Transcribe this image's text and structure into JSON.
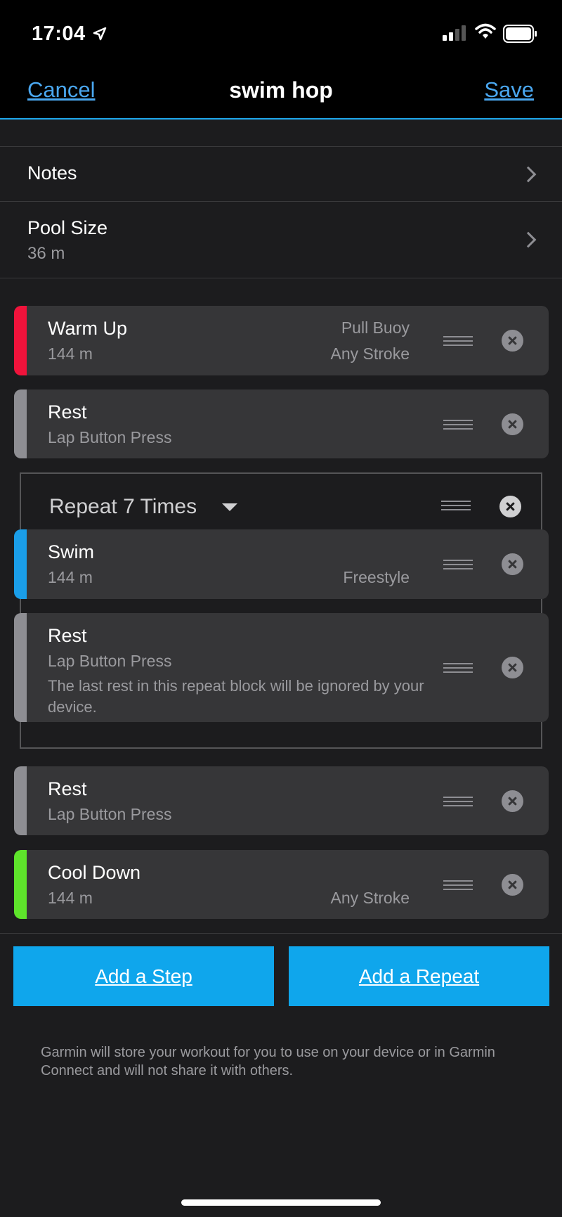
{
  "status_bar": {
    "time": "17:04",
    "icons": [
      "location-arrow-icon",
      "signal-icon",
      "wifi-icon",
      "battery-icon"
    ]
  },
  "navbar": {
    "cancel_label": "Cancel",
    "title": "swim hop",
    "save_label": "Save"
  },
  "settings": {
    "notes_label": "Notes",
    "pool_size_label": "Pool Size",
    "pool_size_value": "36 m"
  },
  "steps": [
    {
      "title": "Warm Up",
      "distance": "144 m",
      "equipment": "Pull Buoy",
      "stroke": "Any Stroke",
      "color": "#f0133b"
    },
    {
      "title": "Rest",
      "detail": "Lap Button Press",
      "color": "#8e8e93"
    }
  ],
  "repeat": {
    "label": "Repeat 7 Times",
    "steps": [
      {
        "title": "Swim",
        "distance": "144 m",
        "stroke": "Freestyle",
        "color": "#1a9ee9"
      },
      {
        "title": "Rest",
        "detail": "Lap Button Press",
        "note": "The last rest in this repeat block will be ignored by your device.",
        "color": "#8e8e93"
      }
    ]
  },
  "steps_after": [
    {
      "title": "Rest",
      "detail": "Lap Button Press",
      "color": "#8e8e93"
    },
    {
      "title": "Cool Down",
      "distance": "144 m",
      "stroke": "Any Stroke",
      "color": "#5ee42b"
    }
  ],
  "actions": {
    "add_step": "Add a Step",
    "add_repeat": "Add a Repeat"
  },
  "disclaimer": "Garmin will store your workout for you to use on your device or in Garmin Connect and will not share it with others.",
  "colors": {
    "accent": "#0fa6ec",
    "link": "#4aa7f0",
    "background": "#1c1c1e",
    "card": "#363638"
  }
}
